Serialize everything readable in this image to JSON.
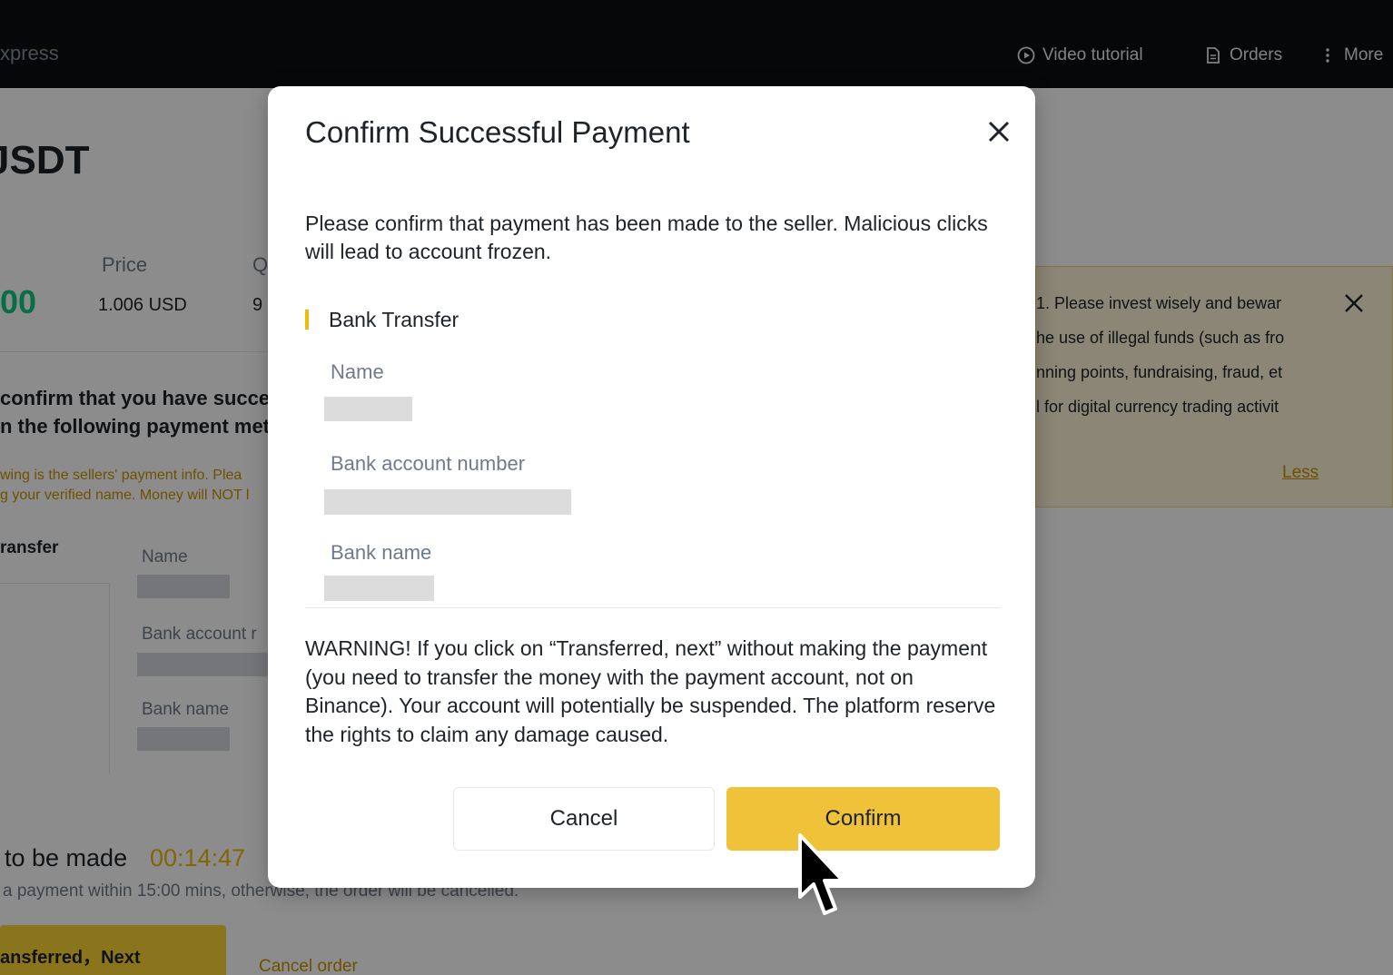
{
  "topbar": {
    "brand": "xpress",
    "video_tutorial": "Video tutorial",
    "orders": "Orders",
    "more": "More"
  },
  "background": {
    "asset": "JSDT",
    "amount_fragment": "00",
    "price_label": "Price",
    "price_value": "1.006 USD",
    "quantity_label_fragment": "Q",
    "quantity_value_fragment": "9",
    "confirm_text_line1": "confirm that you have succe",
    "confirm_text_line2": "n the following payment met",
    "notice_line1": "wing is the sellers' payment info. Plea",
    "notice_line2": "g your verified name. Money will NOT l",
    "method_fragment": "ransfer",
    "name_label": "Name",
    "bank_account_label": "Bank account r",
    "bank_name_label": "Bank name",
    "timer_label": "to be made",
    "timer_value": "00:14:47",
    "deadline_text": "a payment within 15:00 mins, otherwise, the order will be cancelled.",
    "transferred_button": "ansferred，Next",
    "cancel_order": "Cancel order",
    "tips": [
      "1. Please invest wisely and bewar",
      "he use of illegal funds (such as fro",
      "nning points, fundraising, fraud, et",
      "l for digital currency trading activit"
    ],
    "tips_less": "Less"
  },
  "modal": {
    "title": "Confirm Successful Payment",
    "intro": "Please confirm that payment has been made to the seller. Malicious clicks will lead to account frozen.",
    "payment_method": "Bank Transfer",
    "name_label": "Name",
    "bank_account_label": "Bank account number",
    "bank_name_label": "Bank name",
    "warning": "WARNING! If you click on “Transferred, next” without making the payment (you need to transfer the money with the payment account, not on Binance). Your account will potentially be suspended. The platform reserve the rights to claim any damage caused.",
    "cancel_label": "Cancel",
    "confirm_label": "Confirm"
  },
  "colors": {
    "accent": "#f0c239",
    "timer": "#f0b90b",
    "positive": "#0ecb81"
  }
}
